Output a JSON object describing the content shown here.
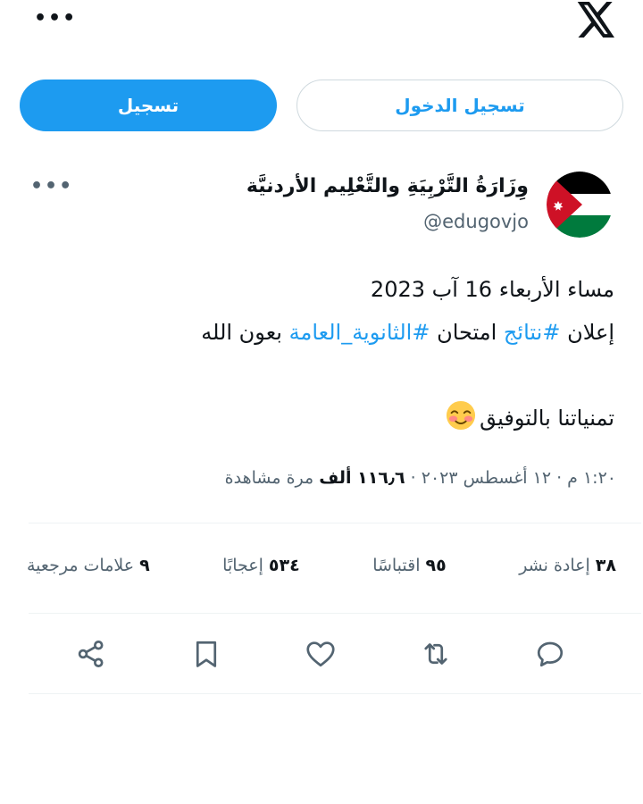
{
  "topbar": {
    "more_label": "•••",
    "logo": "x-logo-icon"
  },
  "auth": {
    "signup_label": "تسجيل",
    "login_label": "تسجيل الدخول"
  },
  "tweet": {
    "author_name": "وِزَارَةُ التَّرْبِيَةِ والتَّعْلِيم الأردنيَّة",
    "handle": "@edugovjo",
    "more_label": "•••",
    "line1": "مساء الأربعاء 16 آب 2023",
    "line2_prefix": "إعلان ",
    "hashtag1": "#نتائج",
    "line2_mid": " امتحان ",
    "hashtag2": "#الثانوية_العامة",
    "line2_suffix": " بعون الله",
    "line3": "تمنياتنا بالتوفيق",
    "emoji": "smiling-face-with-blush-emoji",
    "meta_time": "١:٢٠ م · ١٢ أغسطس ٢٠٢٣ · ",
    "meta_views_count": "١١٦٫٦ ألف",
    "meta_views_label": " مرة مشاهدة"
  },
  "stats": {
    "retweets_count": "٣٨",
    "retweets_label": "إعادة نشر",
    "quotes_count": "٩٥",
    "quotes_label": "اقتباسًا",
    "likes_count": "٥٣٤",
    "likes_label": "إعجابًا",
    "bookmarks_count": "٩",
    "bookmarks_label": "علامات مرجعية"
  },
  "actions": [
    "reply-icon",
    "retweet-icon",
    "like-icon",
    "bookmark-icon",
    "share-icon"
  ],
  "colors": {
    "accent": "#1d9bf0",
    "text": "#0f1419",
    "secondary": "#536471",
    "divider": "#eff3f4",
    "flag_black": "#000000",
    "flag_green": "#007a3d",
    "flag_red": "#ce1126"
  }
}
